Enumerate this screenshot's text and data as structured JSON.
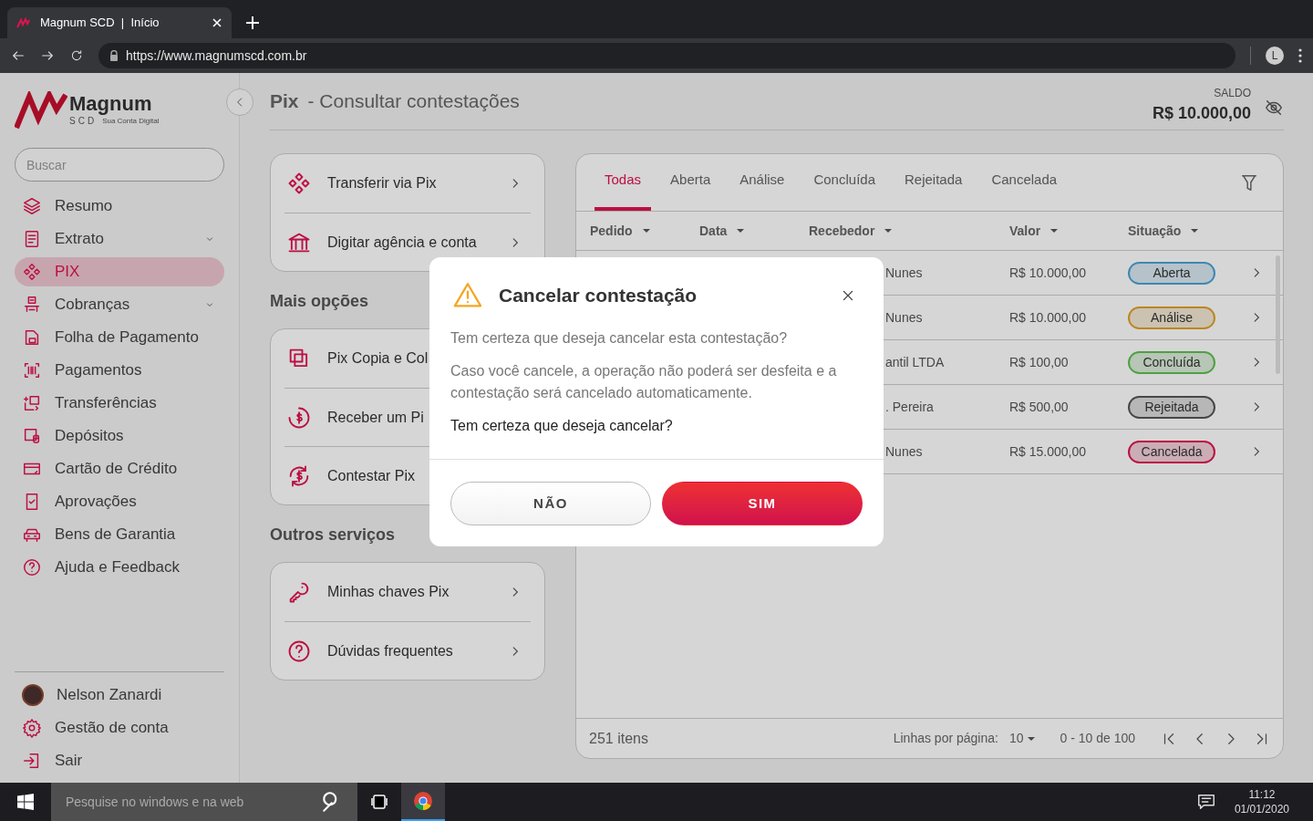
{
  "browser": {
    "tab_title": "Magnum SCD  |  Início",
    "url": "https://www.magnumscd.com.br",
    "profile_initial": "L"
  },
  "sidebar": {
    "logo": {
      "name": "Magnum",
      "sub": "SCD",
      "tagline": "Sua Conta Digital"
    },
    "search": {
      "placeholder": "Buscar"
    },
    "items": [
      {
        "label": "Resumo",
        "selected": false,
        "submenu": false
      },
      {
        "label": "Extrato",
        "selected": false,
        "submenu": true
      },
      {
        "label": "PIX",
        "selected": true,
        "submenu": false
      },
      {
        "label": "Cobranças",
        "selected": false,
        "submenu": true
      },
      {
        "label": "Folha de Pagamento",
        "selected": false,
        "submenu": false
      },
      {
        "label": "Pagamentos",
        "selected": false,
        "submenu": false
      },
      {
        "label": "Transferências",
        "selected": false,
        "submenu": false
      },
      {
        "label": "Depósitos",
        "selected": false,
        "submenu": false
      },
      {
        "label": "Cartão de Crédito",
        "selected": false,
        "submenu": false
      },
      {
        "label": "Aprovações",
        "selected": false,
        "submenu": false
      },
      {
        "label": "Bens de Garantia",
        "selected": false,
        "submenu": false
      },
      {
        "label": "Ajuda e Feedback",
        "selected": false,
        "submenu": false
      }
    ],
    "footer_items": [
      {
        "label": "Nelson Zanardi",
        "kind": "avatar"
      },
      {
        "label": "Gestão de conta",
        "kind": "settings"
      },
      {
        "label": "Sair",
        "kind": "logout"
      }
    ]
  },
  "header": {
    "title": "Pix",
    "subtitle": "- Consultar contestações",
    "balance_label": "SALDO",
    "balance": "R$ 10.000,00"
  },
  "cards": [
    {
      "items": [
        {
          "label": "Transferir via Pix",
          "chevron": true
        },
        {
          "label": "Digitar agência e conta",
          "chevron": true
        }
      ]
    },
    {
      "title": "Mais opções",
      "items": [
        {
          "label": "Pix Copia e Col",
          "chevron": false
        },
        {
          "label": "Receber um Pi",
          "chevron": false
        },
        {
          "label": "Contestar Pix",
          "chevron": false
        }
      ]
    },
    {
      "title": "Outros serviços",
      "items": [
        {
          "label": "Minhas chaves Pix",
          "chevron": true
        },
        {
          "label": "Dúvidas frequentes",
          "chevron": true
        }
      ]
    }
  ],
  "panel": {
    "tabs": [
      {
        "label": "Todas",
        "selected": true
      },
      {
        "label": "Aberta",
        "selected": false
      },
      {
        "label": "Análise",
        "selected": false
      },
      {
        "label": "Concluída",
        "selected": false
      },
      {
        "label": "Rejeitada",
        "selected": false
      },
      {
        "label": "Cancelada",
        "selected": false
      }
    ],
    "columns": [
      "Pedido",
      "Data",
      "Recebedor",
      "Valor",
      "Situação"
    ],
    "rows": [
      {
        "recipient": "Nunes",
        "value": "R$ 10.000,00",
        "status": "Aberta",
        "color": "#3e89b5"
      },
      {
        "recipient": "Nunes",
        "value": "R$ 10.000,00",
        "status": "Análise",
        "color": "#bc8622"
      },
      {
        "recipient": "antil LTDA",
        "value": "R$ 100,00",
        "status": "Concluída",
        "color": "#4da143"
      },
      {
        "recipient": ". Pereira",
        "value": "R$ 500,00",
        "status": "Rejeitada",
        "color": "#474747"
      },
      {
        "recipient": "Nunes",
        "value": "R$ 15.000,00",
        "status": "Cancelada",
        "color": "#bc1042"
      }
    ],
    "footer": {
      "count": "251 itens",
      "rows_label": "Linhas por página:",
      "rows_value": "10",
      "range": "0 - 10 de 100"
    }
  },
  "modal": {
    "title": "Cancelar contestação",
    "texts": [
      "Tem certeza que deseja cancelar esta contestação?",
      "Caso você cancele, a operação não poderá ser desfeita e a contestação será cancelado automaticamente.",
      "Tem certeza que deseja cancelar?"
    ],
    "buttons": [
      {
        "label": "NÃO",
        "kind": "secondary"
      },
      {
        "label": "SIM",
        "kind": "primary"
      }
    ]
  },
  "taskbar": {
    "search_placeholder": "Pesquise no windows e na web",
    "time": "11:12",
    "date": "01/01/2020"
  }
}
